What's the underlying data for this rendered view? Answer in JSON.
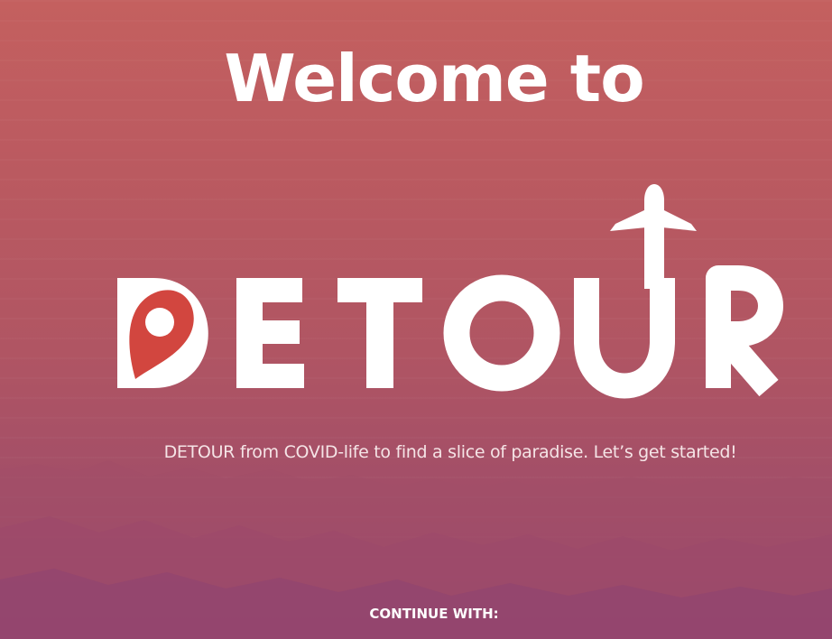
{
  "header": {
    "title": "Welcome to"
  },
  "logo": {
    "brand": "DETOUR",
    "pin_icon": "map-pin-icon",
    "plane_icon": "airplane-icon",
    "pin_color": "#d2463f"
  },
  "intro": {
    "tagline": "DETOUR from COVID-life to find a slice of paradise. Let’s get started!"
  },
  "auth": {
    "continue_label": "CONTINUE WITH:"
  },
  "colors": {
    "background_top": "#c4605f",
    "background_bottom": "#8f4570",
    "text": "#ffffff"
  }
}
